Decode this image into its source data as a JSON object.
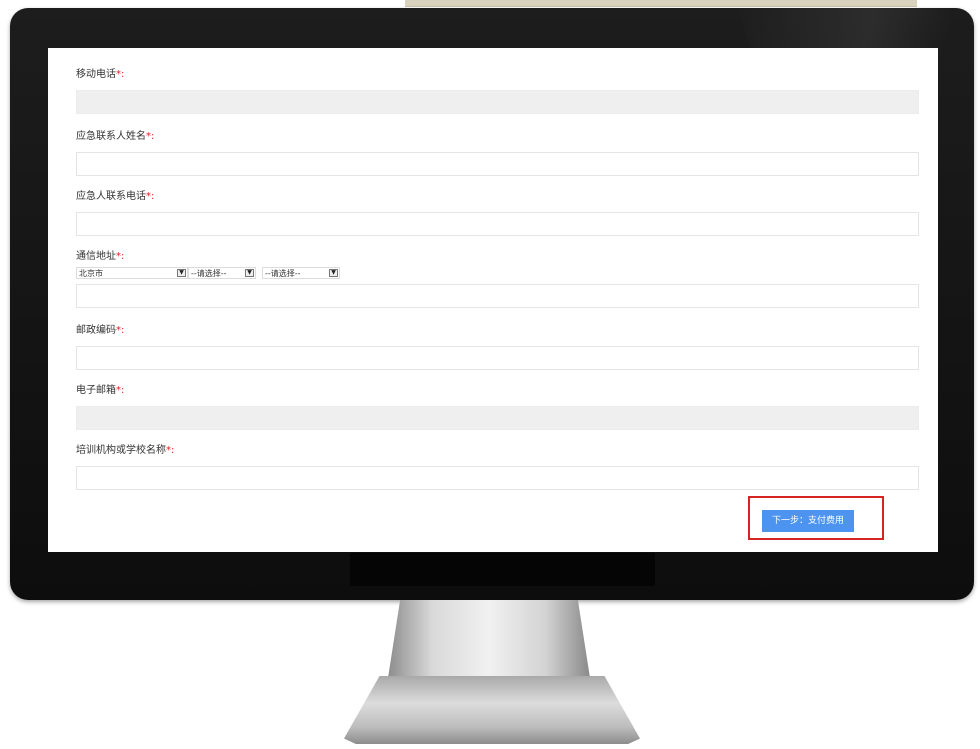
{
  "required_mark": "*:",
  "form": {
    "mobile": {
      "label": "移动电话",
      "value": ""
    },
    "emergency_name": {
      "label": "应急联系人姓名",
      "value": ""
    },
    "emergency_phone": {
      "label": "应急人联系电话",
      "value": ""
    },
    "address": {
      "label": "通信地址",
      "province": "北京市",
      "city": "--请选择--",
      "district": "--请选择--",
      "value": ""
    },
    "postcode": {
      "label": "邮政编码",
      "value": ""
    },
    "email": {
      "label": "电子邮箱",
      "value": ""
    },
    "school": {
      "label": "培训机构或学校名称",
      "value": ""
    }
  },
  "next_button": "下一步：支付费用",
  "colors": {
    "button": "#4d94f0",
    "highlight": "#d62424",
    "required": "#e02020"
  },
  "icons": {
    "select_arrow": "chevron-down-icon"
  }
}
